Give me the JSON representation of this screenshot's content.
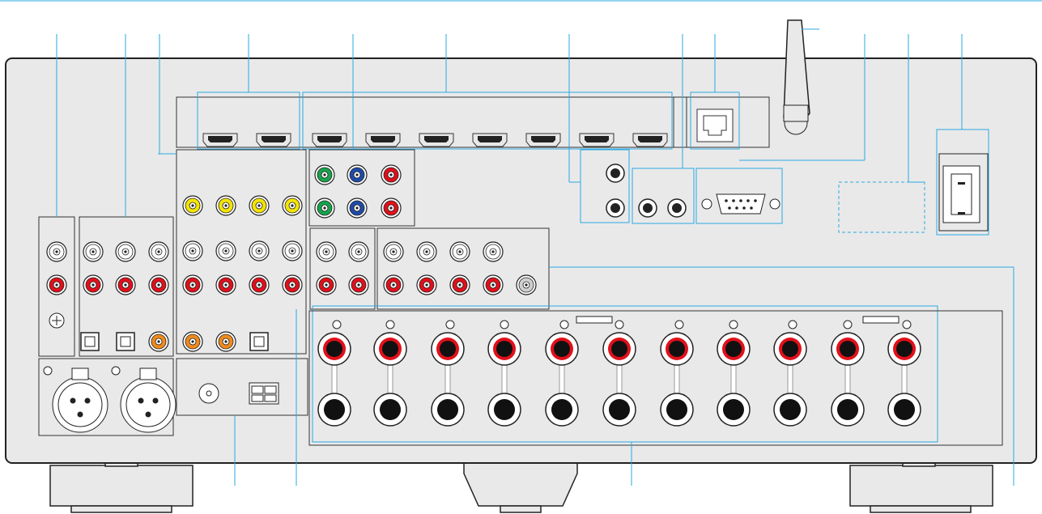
{
  "figure": {
    "description_visible_text": [],
    "colors": {
      "accent_line": "#2aa9e0",
      "jack_red": "#e0101a",
      "jack_white": "#ffffff",
      "jack_yellow": "#f4e400",
      "jack_orange": "#f08a1c",
      "jack_green": "#16a34a",
      "jack_blue": "#1f4aa8",
      "panel_fill": "#e9e9ea",
      "outline": "#222222"
    },
    "callout_count": 16
  }
}
